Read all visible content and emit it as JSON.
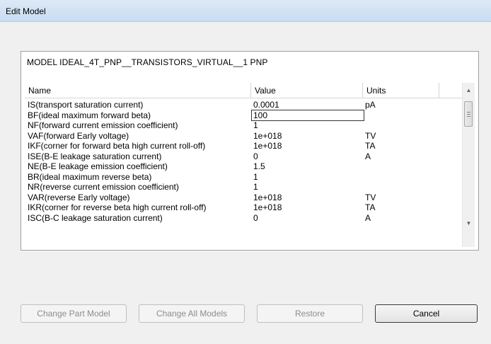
{
  "window": {
    "title": "Edit Model"
  },
  "model": {
    "label": "MODEL IDEAL_4T_PNP__TRANSISTORS_VIRTUAL__1 PNP"
  },
  "table": {
    "columns": [
      "Name",
      "Value",
      "Units"
    ],
    "rows": [
      {
        "name": "IS(transport saturation current)",
        "value": "0.0001",
        "units": "pA"
      },
      {
        "name": "BF(ideal maximum forward beta)",
        "value": "100",
        "units": ""
      },
      {
        "name": "NF(forward current emission coefficient)",
        "value": "1",
        "units": ""
      },
      {
        "name": "VAF(forward Early voltage)",
        "value": "1e+018",
        "units": "TV"
      },
      {
        "name": "IKF(corner for forward beta high current roll-off)",
        "value": "1e+018",
        "units": "TA"
      },
      {
        "name": "ISE(B-E leakage saturation current)",
        "value": "0",
        "units": "A"
      },
      {
        "name": "NE(B-E leakage emission coefficient)",
        "value": "1.5",
        "units": ""
      },
      {
        "name": "BR(ideal maximum reverse beta)",
        "value": "1",
        "units": ""
      },
      {
        "name": "NR(reverse current emission coefficient)",
        "value": "1",
        "units": ""
      },
      {
        "name": "VAR(reverse Early voltage)",
        "value": "1e+018",
        "units": "TV"
      },
      {
        "name": "IKR(corner for reverse beta high current roll-off)",
        "value": "1e+018",
        "units": "TA"
      },
      {
        "name": "ISC(B-C leakage saturation current)",
        "value": "0",
        "units": "A"
      }
    ],
    "editing_row": 1
  },
  "buttons": {
    "change_part_model": "Change Part Model",
    "change_all_models": "Change All Models",
    "restore": "Restore",
    "cancel": "Cancel"
  },
  "icons": {
    "scroll_up": "scroll-up-arrow-icon",
    "scroll_down": "scroll-down-arrow-icon"
  }
}
